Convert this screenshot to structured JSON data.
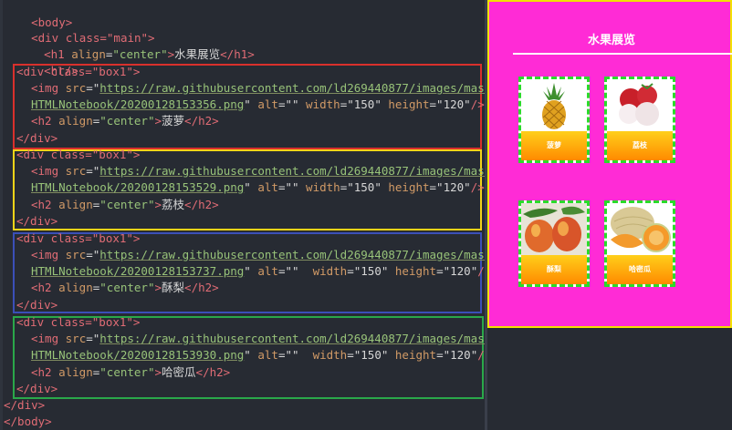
{
  "code": {
    "body_open": "<body>",
    "div_main_open": "<div class=\"main\">",
    "h1_line": {
      "open": "<h1 ",
      "attr": "align",
      "eq": "=",
      "val": "\"center\"",
      "close": ">",
      "text": "水果展览",
      "end": "</h1>"
    },
    "hr": "<hr/>",
    "boxes": [
      {
        "open": "<div class=\"box1\">",
        "img_url_1": "https://raw.githubusercontent.com/ld269440877/images/master/",
        "img_url_2": "HTMLNotebook/20200128153356.png",
        "h2_text": "菠萝"
      },
      {
        "open": "<div class=\"box1\">",
        "img_url_1": "https://raw.githubusercontent.com/ld269440877/images/master/",
        "img_url_2": "HTMLNotebook/20200128153529.png",
        "h2_text": "荔枝"
      },
      {
        "open": "<div class=\"box1\">",
        "img_url_1": "https://raw.githubusercontent.com/ld269440877/images/master/",
        "img_url_2": "HTMLNotebook/20200128153737.png",
        "h2_text": "酥梨"
      },
      {
        "open": "<div class=\"box1\">",
        "img_url_1": "https://raw.githubusercontent.com/ld269440877/images/master/",
        "img_url_2": "HTMLNotebook/20200128153930.png",
        "h2_text": "哈密瓜"
      }
    ],
    "div_close": "</div>",
    "body_close": "</body>"
  },
  "preview": {
    "title": "水果展览",
    "items": [
      {
        "label": "菠萝",
        "icon": "pineapple-image"
      },
      {
        "label": "荔枝",
        "icon": "lychee-image"
      },
      {
        "label": "酥梨",
        "icon": "pear-image"
      },
      {
        "label": "哈密瓜",
        "icon": "melon-image"
      }
    ]
  },
  "colors": {
    "highlight_1": "#d9302c",
    "highlight_2": "#f2d318",
    "highlight_3": "#3b4fb8",
    "highlight_4": "#2aa84a",
    "preview_bg": "#ff2bd6",
    "preview_border": "#f2e200",
    "box_border": "#2bdb2b"
  }
}
